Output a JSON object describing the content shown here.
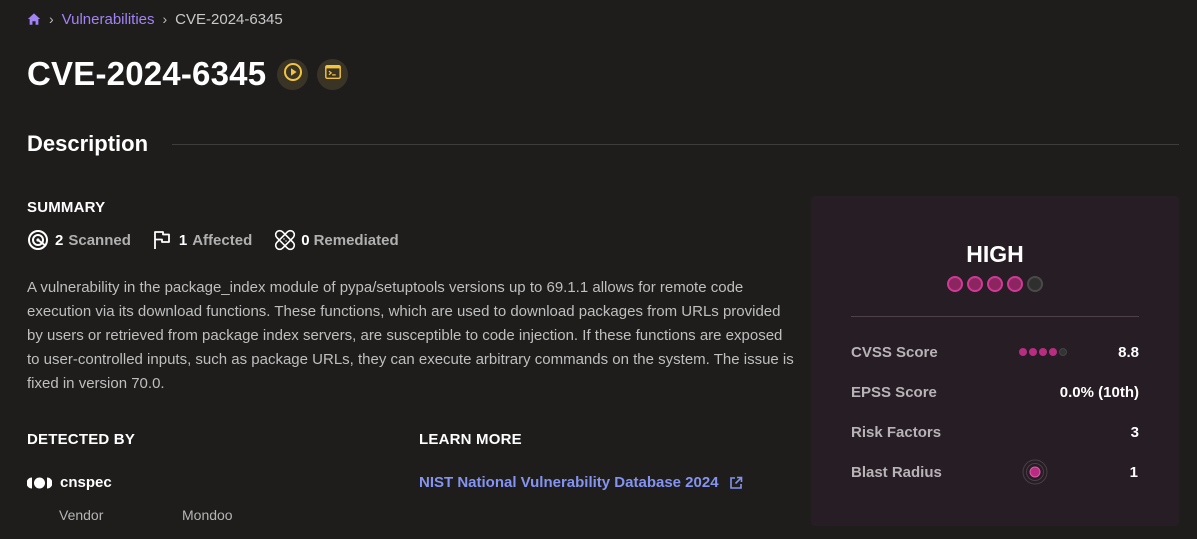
{
  "breadcrumb": {
    "home_icon": "home-icon",
    "items": [
      {
        "label": "Vulnerabilities",
        "link": true
      },
      {
        "label": "CVE-2024-6345",
        "link": false
      }
    ],
    "separator": "›"
  },
  "header": {
    "title": "CVE-2024-6345",
    "actions": [
      {
        "icon": "play-circle-icon",
        "color": "#f2c43d"
      },
      {
        "icon": "terminal-icon",
        "color": "#f2c43d"
      }
    ]
  },
  "description_section": {
    "heading": "Description",
    "summary_label": "SUMMARY",
    "stats": [
      {
        "icon": "radar-icon",
        "count": "2",
        "label": "Scanned"
      },
      {
        "icon": "flag-icon",
        "count": "1",
        "label": "Affected"
      },
      {
        "icon": "bandage-icon",
        "count": "0",
        "label": "Remediated"
      }
    ],
    "text": "A vulnerability in the package_index module of pypa/setuptools versions up to 69.1.1 allows for remote code execution via its download functions. These functions, which are used to download packages from URLs provided by users or retrieved from package index servers, are susceptible to code injection. If these functions are exposed to user-controlled inputs, such as package URLs, they can execute arbitrary commands on the system. The issue is fixed in version 70.0."
  },
  "detected_by": {
    "label": "DETECTED BY",
    "detector": {
      "logo_icon": "cnspec-logo-icon",
      "name": "cnspec",
      "vendor_key": "Vendor",
      "vendor_value": "Mondoo"
    }
  },
  "learn_more": {
    "label": "LEARN MORE",
    "link_text": "NIST National Vulnerability Database 2024",
    "link_icon": "external-link-icon"
  },
  "severity": {
    "level": "HIGH",
    "rating": 4,
    "rating_max": 5,
    "accent_color": "#d03a96",
    "metrics": [
      {
        "label": "CVSS Score",
        "value": "8.8",
        "dots": 4,
        "dots_max": 5
      },
      {
        "label": "EPSS Score",
        "value": "0.0% (10th)"
      },
      {
        "label": "Risk Factors",
        "value": "3"
      },
      {
        "label": "Blast Radius",
        "value": "1",
        "icon": "blast-radius-icon"
      }
    ]
  }
}
